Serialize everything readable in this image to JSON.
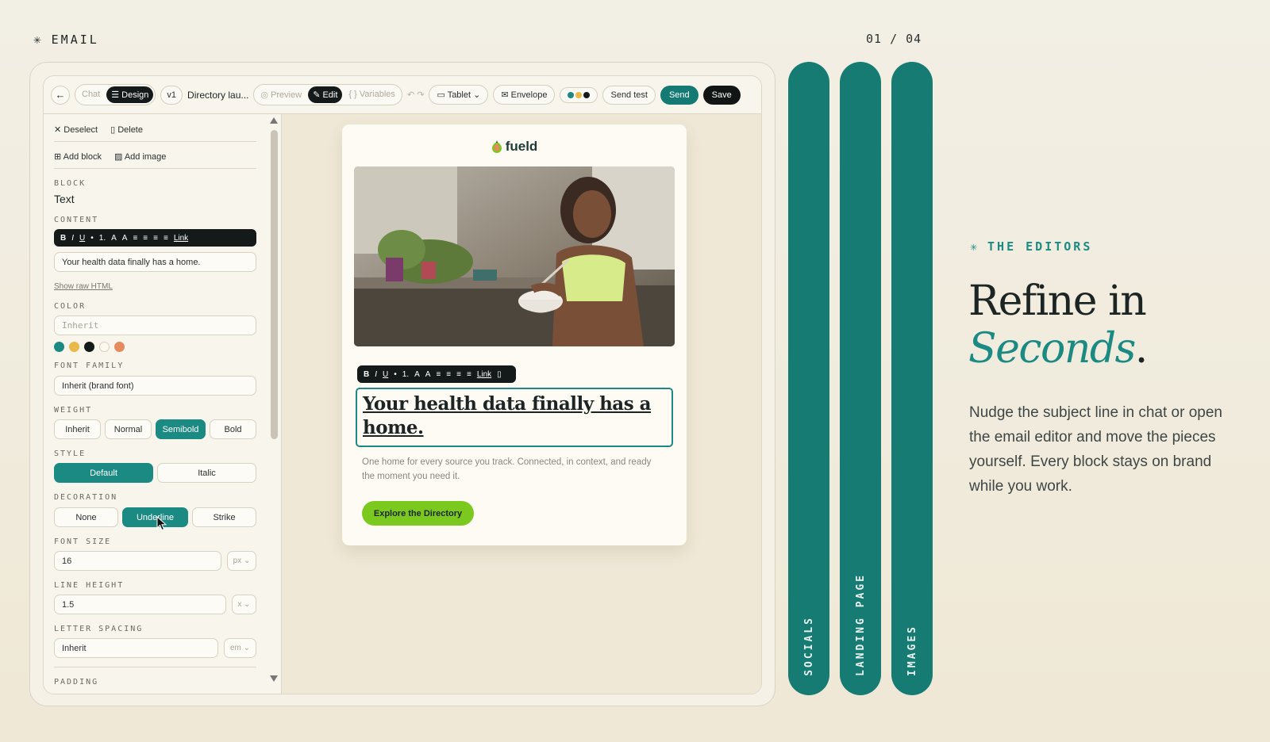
{
  "header": {
    "section": "EMAIL",
    "page_counter": "01 / 04"
  },
  "toolbar": {
    "back": "←",
    "mode_chat": "Chat",
    "mode_design": "☰ Design",
    "version": "v1",
    "title": "Directory lau...",
    "view_preview": "◎ Preview",
    "view_edit": "✎ Edit",
    "view_variables": "{ } Variables",
    "undo": "↶ ↷",
    "device": "▭ Tablet ⌄",
    "envelope": "✉ Envelope",
    "send_test": "Send test",
    "send": "Send",
    "save": "Save"
  },
  "panel": {
    "deselect": "✕ Deselect",
    "delete": "▯ Delete",
    "add_block": "⊞ Add block",
    "add_image": "▨ Add image",
    "block_label": "BLOCK",
    "block_value": "Text",
    "content_label": "CONTENT",
    "rte": [
      "B",
      "I",
      "U",
      "•",
      "1.",
      "A",
      "A",
      "≡",
      "≡",
      "≡",
      "≡",
      "Link"
    ],
    "content_value": "Your health data finally has a home.",
    "show_raw": "Show raw HTML",
    "color_label": "COLOR",
    "color_placeholder": "Inherit",
    "swatches": [
      "#1b8a83",
      "#e9b949",
      "#141a19",
      "#fbf8ef",
      "#e58b5e"
    ],
    "font_family_label": "FONT FAMILY",
    "font_family_value": "Inherit (brand font)",
    "weight_label": "WEIGHT",
    "weight_options": [
      "Inherit",
      "Normal",
      "Semibold",
      "Bold"
    ],
    "weight_selected": "Semibold",
    "style_label": "STYLE",
    "style_options": [
      "Default",
      "Italic"
    ],
    "decoration_label": "DECORATION",
    "decoration_options": [
      "None",
      "Underline",
      "Strike"
    ],
    "font_size_label": "FONT SIZE",
    "font_size_value": "16",
    "font_size_unit": "px ⌄",
    "line_height_label": "LINE HEIGHT",
    "line_height_value": "1.5",
    "line_height_unit": "x ⌄",
    "letter_spacing_label": "LETTER SPACING",
    "letter_spacing_value": "Inherit",
    "letter_spacing_unit": "em ⌄",
    "padding_label": "PADDING"
  },
  "email": {
    "brand": "fueld",
    "rte": [
      "B",
      "I",
      "U",
      "•",
      "1.",
      "A",
      "A",
      "≡",
      "≡",
      "≡",
      "≡",
      "Link",
      "▯"
    ],
    "headline": "Your health data finally has a home.",
    "body": "One home for every source you track. Connected, in context, and ready the moment you need it.",
    "cta": "Explore the Directory"
  },
  "tabs": [
    "SOCIALS",
    "LANDING PAGE",
    "IMAGES"
  ],
  "copy": {
    "eyebrow": "THE EDITORS",
    "title_line1": "Refine in",
    "title_em": "Seconds",
    "title_end": ".",
    "paragraph": "Nudge the subject line in chat or open the email editor and move the pieces yourself. Every block stays on brand while you work."
  },
  "colors": {
    "teal": "#167b73",
    "accent_green": "#7bc91f",
    "dark": "#141a19"
  }
}
